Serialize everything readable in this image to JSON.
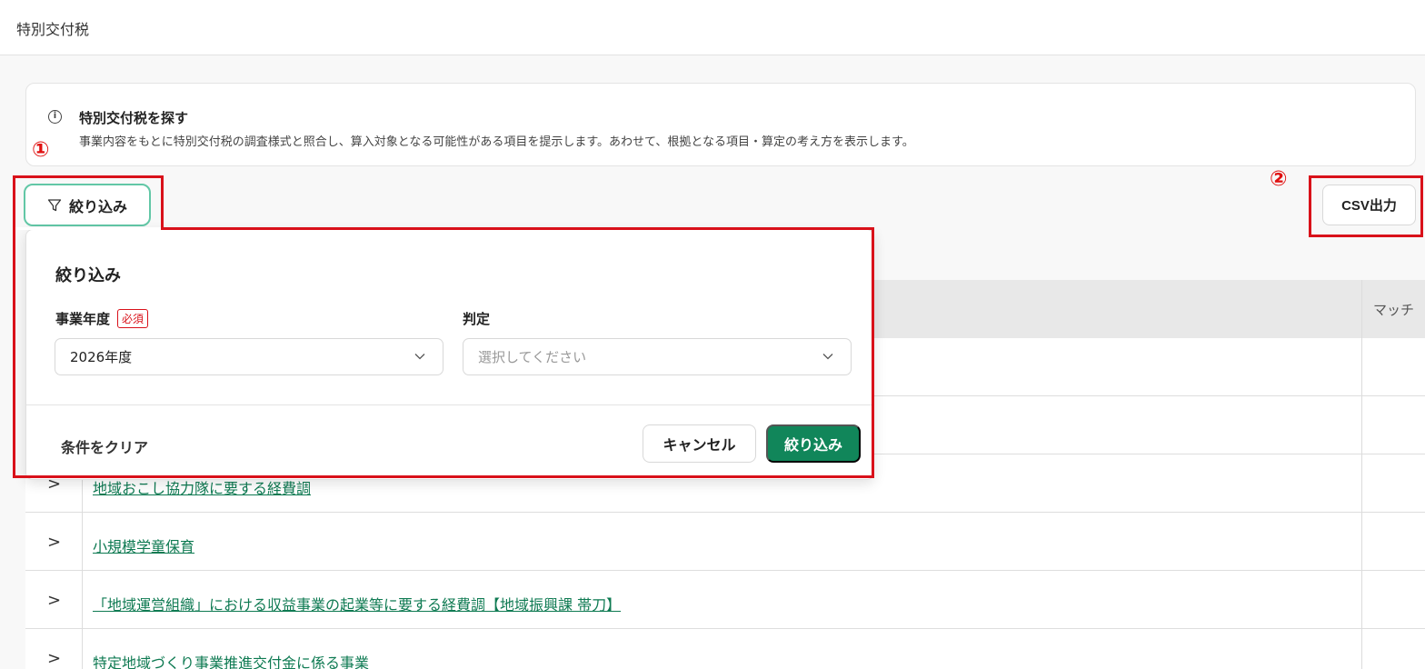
{
  "header": {
    "title": "特別交付税"
  },
  "info": {
    "icon": "info-circle-icon",
    "title": "特別交付税を探す",
    "description": "事業内容をもとに特別交付税の調査様式と照合し、算入対象となる可能性がある項目を提示します。あわせて、根拠となる項目・算定の考え方を表示します。"
  },
  "annotations": {
    "marker1": "①",
    "marker2": "②",
    "color": "#d9111a"
  },
  "toolbar": {
    "filter_label": "絞り込み",
    "csv_label": "CSV出力",
    "filter_icon": "funnel-icon"
  },
  "table": {
    "header_match": "マッチ",
    "rows": [
      {
        "label": "地域おこし協力隊に要する経費調"
      },
      {
        "label": "小規模学童保育"
      },
      {
        "label": "「地域運営組織」における収益事業の起業等に要する経費調【地域振興課 帯刀】"
      },
      {
        "label": "特定地域づくり事業推進交付金に係る事業"
      }
    ]
  },
  "filter_panel": {
    "title": "絞り込み",
    "fiscal_year": {
      "label": "事業年度",
      "required_badge": "必須",
      "value": "2026年度"
    },
    "judgement": {
      "label": "判定",
      "placeholder": "選択してください"
    },
    "clear_label": "条件をクリア",
    "cancel_label": "キャンセル",
    "apply_label": "絞り込み"
  },
  "colors": {
    "accent": "#11865a",
    "link": "#0e7a52",
    "toggle_border": "#62c7a6"
  }
}
